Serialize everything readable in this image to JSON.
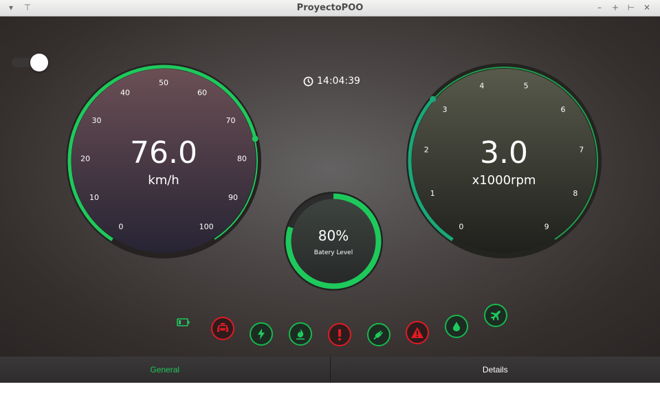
{
  "window": {
    "title": "ProyectoPOO"
  },
  "colors": {
    "accent": "#1ec95c",
    "alert": "#e01b24"
  },
  "clock": {
    "time": "14:04:39"
  },
  "speed_gauge": {
    "value": "76.0",
    "unit": "km/h",
    "ticks": [
      "0",
      "10",
      "20",
      "30",
      "40",
      "50",
      "60",
      "70",
      "80",
      "90",
      "100"
    ],
    "min": 0,
    "max": 100,
    "current": 76
  },
  "rpm_gauge": {
    "value": "3.0",
    "unit": "x1000rpm",
    "ticks": [
      "0",
      "1",
      "2",
      "3",
      "4",
      "5",
      "6",
      "7",
      "8",
      "9"
    ],
    "min": 0,
    "max": 9,
    "current": 3
  },
  "battery": {
    "percent_label": "80%",
    "label": "Batery Level",
    "level": 0.8
  },
  "indicators": [
    {
      "icon": "battery-icon",
      "state": "ok"
    },
    {
      "icon": "car-icon",
      "state": "alert"
    },
    {
      "icon": "lightning-icon",
      "state": "ok"
    },
    {
      "icon": "flame-icon",
      "state": "ok"
    },
    {
      "icon": "exclamation-icon",
      "state": "alert"
    },
    {
      "icon": "plug-icon",
      "state": "ok"
    },
    {
      "icon": "warning-triangle-icon",
      "state": "alert"
    },
    {
      "icon": "water-drop-icon",
      "state": "ok"
    },
    {
      "icon": "airplane-icon",
      "state": "ok"
    }
  ],
  "tabs": [
    {
      "label": "General",
      "active": true
    },
    {
      "label": "Details",
      "active": false
    }
  ]
}
